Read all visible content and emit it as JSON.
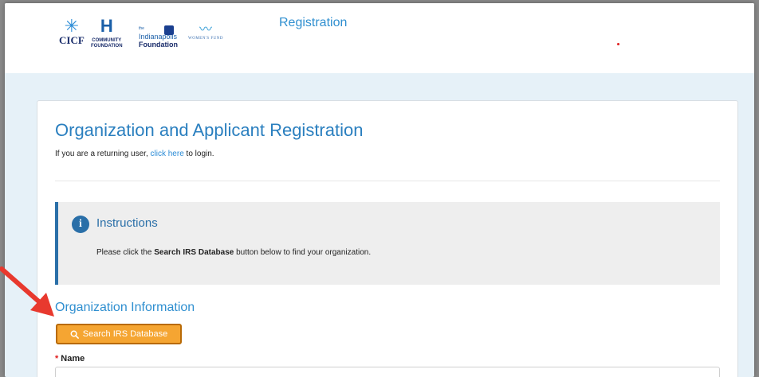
{
  "header": {
    "title": "Registration",
    "logos": {
      "cicf": {
        "name": "CICF"
      },
      "hamilton": {
        "line1": "COMMUNITY",
        "line2": "FOUNDATION"
      },
      "indianapolis": {
        "the": "the",
        "line1": "Indianapolis",
        "line2": "Foundation"
      },
      "womens_fund": {
        "name": "WOMEN'S FUND"
      }
    }
  },
  "page": {
    "title": "Organization and Applicant Registration",
    "returning_prefix": "If you are a returning user,",
    "returning_link": "click here",
    "returning_suffix": "to login."
  },
  "instructions": {
    "title": "Instructions",
    "text_prefix": "Please click the",
    "text_bold": "Search IRS Database",
    "text_suffix": "button below to find your organization."
  },
  "organization": {
    "section_title": "Organization Information",
    "search_button_label": "Search IRS Database",
    "name_label": "Name",
    "required_marker": "*"
  },
  "colors": {
    "accent": "#2a7fbf",
    "button": "#f5a532",
    "arrow": "#e8392e"
  },
  "icons": [
    "info-icon",
    "search-icon",
    "annotation-arrow"
  ]
}
